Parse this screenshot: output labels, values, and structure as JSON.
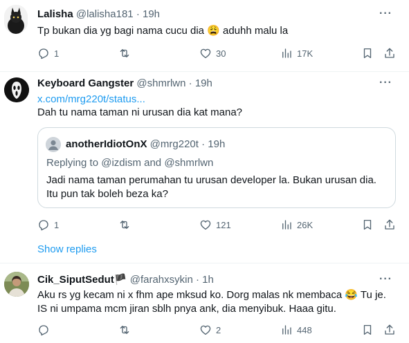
{
  "tweets": [
    {
      "name": "Lalisha",
      "handle": "@lalisha181",
      "separator": "·",
      "time": "19h",
      "text": "Tp bukan dia yg bagi nama cucu dia 😩 aduhh malu la",
      "replies": "1",
      "retweets": "",
      "likes": "30",
      "views": "17K"
    },
    {
      "name": "Keyboard Gangster",
      "handle": "@shmrlwn",
      "separator": "·",
      "time": "19h",
      "link": "x.com/mrg220t/status...",
      "text": "Dah tu nama taman ni urusan dia kat mana?",
      "quote": {
        "name": "anotherIdiotOnX",
        "handle": "@mrg220t",
        "separator": "·",
        "time": "19h",
        "replying_prefix": "Replying to ",
        "replying_to_1": "@izdism",
        "replying_and": " and ",
        "replying_to_2": "@shmrlwn",
        "text_line1": "Jadi nama taman perumahan tu urusan developer la. Bukan urusan dia.",
        "text_line2": "Itu pun tak boleh beza ka?"
      },
      "replies": "1",
      "retweets": "",
      "likes": "121",
      "views": "26K"
    },
    {
      "name": "Cik_SiputSedut",
      "flag": "🏴",
      "handle": "@farahxsykin",
      "separator": "·",
      "time": "1h",
      "text_line1": "Aku rs yg kecam ni x fhm ape mksud ko. Dorg malas nk membaca 😂 Tu je.",
      "text_line2": "IS ni umpama mcm jiran sblh pnya ank, dia menyibuk. Haaa gitu.",
      "replies": "",
      "retweets": "",
      "likes": "2",
      "views": "448"
    }
  ],
  "show_replies": "Show replies",
  "more_label": "···"
}
